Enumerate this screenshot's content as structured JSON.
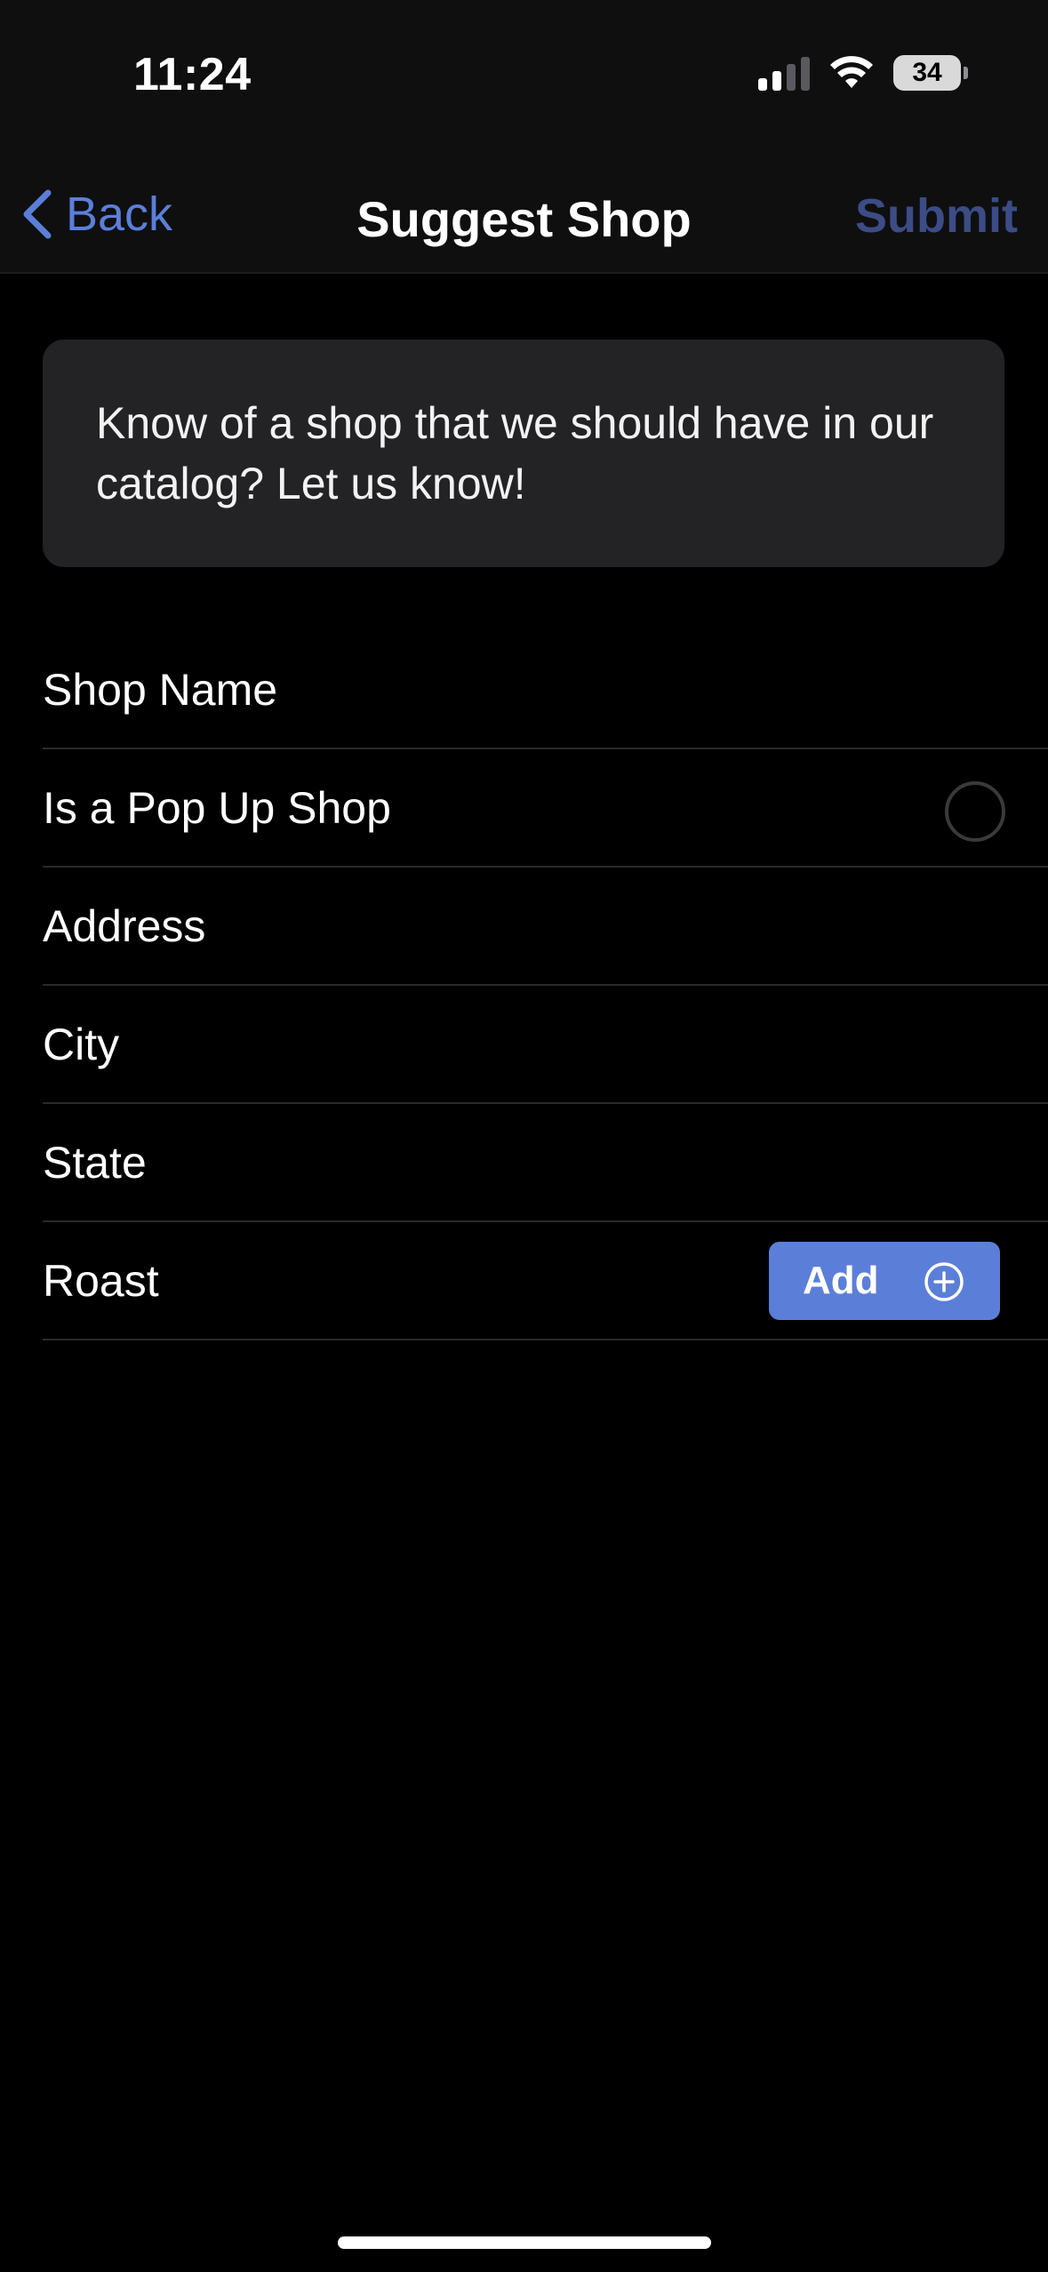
{
  "status_bar": {
    "time": "11:24",
    "battery": "34",
    "icons": [
      "cellular-signal-icon",
      "wifi-icon",
      "battery-icon"
    ]
  },
  "nav": {
    "back_label": "Back",
    "title": "Suggest Shop",
    "submit_label": "Submit"
  },
  "intro": {
    "text": "Know of a shop that we should have in our catalog? Let us know!"
  },
  "form": {
    "shop_name_label": "Shop Name",
    "popup_label": "Is a Pop Up Shop",
    "popup_selected": false,
    "address_label": "Address",
    "city_label": "City",
    "state_label": "State",
    "roast_label": "Roast",
    "add_label": "Add"
  },
  "colors": {
    "accent": "#5b7fd9",
    "submit_disabled": "#3b4c86",
    "background": "#000000",
    "card": "#232326"
  }
}
